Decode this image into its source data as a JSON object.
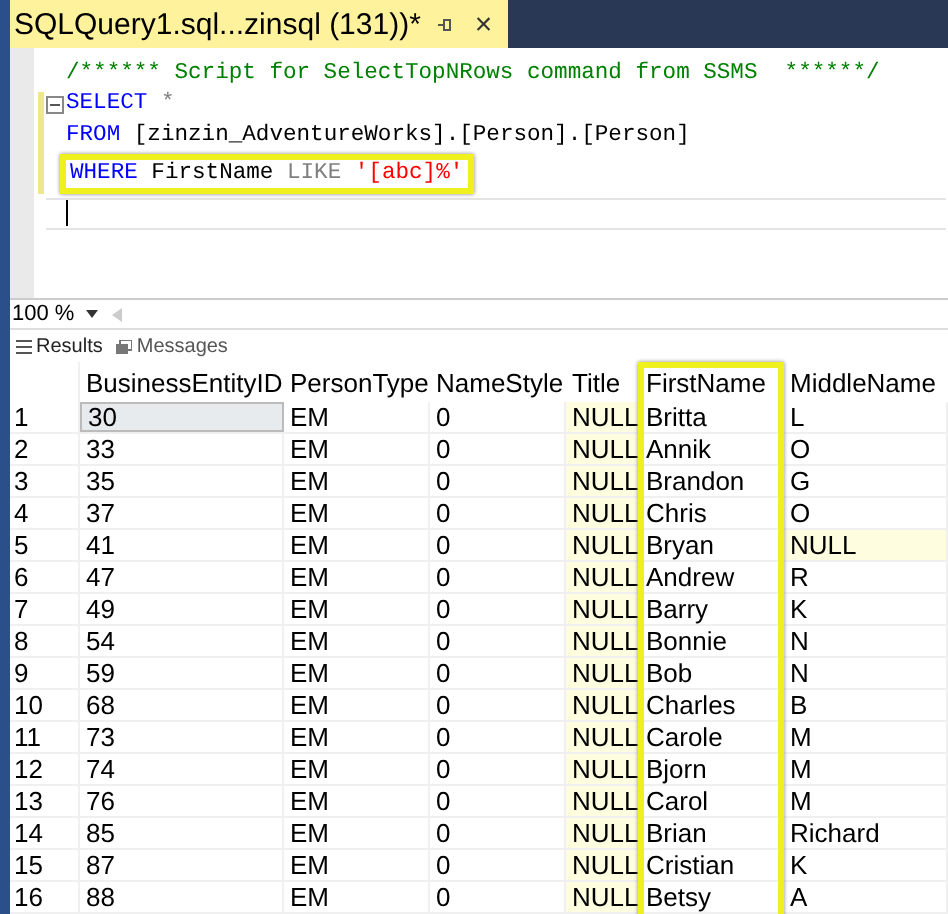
{
  "tab": {
    "title": "SQLQuery1.sql...zinsql (131))*",
    "close": "×"
  },
  "editor": {
    "lines": [
      {
        "tokens": [
          {
            "text": "/****** Script for SelectTopNRows command from SSMS  ******/",
            "kind": "comment"
          }
        ]
      },
      {
        "tokens": [
          {
            "text": "SELECT",
            "kind": "keyword"
          },
          {
            "text": " *",
            "kind": "operator"
          }
        ],
        "foldable": true
      },
      {
        "tokens": [
          {
            "text": "FROM",
            "kind": "keyword"
          },
          {
            "text": " [zinzin_AdventureWorks].[Person].[Person]",
            "kind": "identifier"
          }
        ]
      },
      {
        "tokens": [
          {
            "text": "WHERE",
            "kind": "keyword"
          },
          {
            "text": " FirstName ",
            "kind": "identifier"
          },
          {
            "text": "LIKE",
            "kind": "operator"
          },
          {
            "text": " '[abc]%'",
            "kind": "string"
          }
        ],
        "highlighted": true
      }
    ]
  },
  "zoom": {
    "value": "100 %"
  },
  "result_tabs": [
    {
      "label": "Results",
      "selected": true
    },
    {
      "label": "Messages",
      "selected": false
    }
  ],
  "table": {
    "columns": [
      "BusinessEntityID",
      "PersonType",
      "NameStyle",
      "Title",
      "FirstName",
      "MiddleName"
    ],
    "rows": [
      {
        "number": "1",
        "cells": [
          {
            "text": "30",
            "selected": true
          },
          {
            "text": "EM"
          },
          {
            "text": "0"
          },
          {
            "text": "NULL",
            "null": true
          },
          {
            "text": "Britta"
          },
          {
            "text": "L"
          }
        ]
      },
      {
        "number": "2",
        "cells": [
          {
            "text": "33"
          },
          {
            "text": "EM"
          },
          {
            "text": "0"
          },
          {
            "text": "NULL",
            "null": true
          },
          {
            "text": "Annik"
          },
          {
            "text": "O"
          }
        ]
      },
      {
        "number": "3",
        "cells": [
          {
            "text": "35"
          },
          {
            "text": "EM"
          },
          {
            "text": "0"
          },
          {
            "text": "NULL",
            "null": true
          },
          {
            "text": "Brandon"
          },
          {
            "text": "G"
          }
        ]
      },
      {
        "number": "4",
        "cells": [
          {
            "text": "37"
          },
          {
            "text": "EM"
          },
          {
            "text": "0"
          },
          {
            "text": "NULL",
            "null": true
          },
          {
            "text": "Chris"
          },
          {
            "text": "O"
          }
        ]
      },
      {
        "number": "5",
        "cells": [
          {
            "text": "41"
          },
          {
            "text": "EM"
          },
          {
            "text": "0"
          },
          {
            "text": "NULL",
            "null": true
          },
          {
            "text": "Bryan"
          },
          {
            "text": "NULL",
            "null": true
          }
        ]
      },
      {
        "number": "6",
        "cells": [
          {
            "text": "47"
          },
          {
            "text": "EM"
          },
          {
            "text": "0"
          },
          {
            "text": "NULL",
            "null": true
          },
          {
            "text": "Andrew"
          },
          {
            "text": "R"
          }
        ]
      },
      {
        "number": "7",
        "cells": [
          {
            "text": "49"
          },
          {
            "text": "EM"
          },
          {
            "text": "0"
          },
          {
            "text": "NULL",
            "null": true
          },
          {
            "text": "Barry"
          },
          {
            "text": "K"
          }
        ]
      },
      {
        "number": "8",
        "cells": [
          {
            "text": "54"
          },
          {
            "text": "EM"
          },
          {
            "text": "0"
          },
          {
            "text": "NULL",
            "null": true
          },
          {
            "text": "Bonnie"
          },
          {
            "text": "N"
          }
        ]
      },
      {
        "number": "9",
        "cells": [
          {
            "text": "59"
          },
          {
            "text": "EM"
          },
          {
            "text": "0"
          },
          {
            "text": "NULL",
            "null": true
          },
          {
            "text": "Bob"
          },
          {
            "text": "N"
          }
        ]
      },
      {
        "number": "10",
        "cells": [
          {
            "text": "68"
          },
          {
            "text": "EM"
          },
          {
            "text": "0"
          },
          {
            "text": "NULL",
            "null": true
          },
          {
            "text": "Charles"
          },
          {
            "text": "B"
          }
        ]
      },
      {
        "number": "11",
        "cells": [
          {
            "text": "73"
          },
          {
            "text": "EM"
          },
          {
            "text": "0"
          },
          {
            "text": "NULL",
            "null": true
          },
          {
            "text": "Carole"
          },
          {
            "text": "M"
          }
        ]
      },
      {
        "number": "12",
        "cells": [
          {
            "text": "74"
          },
          {
            "text": "EM"
          },
          {
            "text": "0"
          },
          {
            "text": "NULL",
            "null": true
          },
          {
            "text": "Bjorn"
          },
          {
            "text": "M"
          }
        ]
      },
      {
        "number": "13",
        "cells": [
          {
            "text": "76"
          },
          {
            "text": "EM"
          },
          {
            "text": "0"
          },
          {
            "text": "NULL",
            "null": true
          },
          {
            "text": "Carol"
          },
          {
            "text": "M"
          }
        ]
      },
      {
        "number": "14",
        "cells": [
          {
            "text": "85"
          },
          {
            "text": "EM"
          },
          {
            "text": "0"
          },
          {
            "text": "NULL",
            "null": true
          },
          {
            "text": "Brian"
          },
          {
            "text": "Richard"
          }
        ]
      },
      {
        "number": "15",
        "cells": [
          {
            "text": "87"
          },
          {
            "text": "EM"
          },
          {
            "text": "0"
          },
          {
            "text": "NULL",
            "null": true
          },
          {
            "text": "Cristian"
          },
          {
            "text": "K"
          }
        ]
      },
      {
        "number": "16",
        "cells": [
          {
            "text": "88"
          },
          {
            "text": "EM"
          },
          {
            "text": "0"
          },
          {
            "text": "NULL",
            "null": true
          },
          {
            "text": "Betsy"
          },
          {
            "text": "A"
          }
        ]
      }
    ]
  }
}
